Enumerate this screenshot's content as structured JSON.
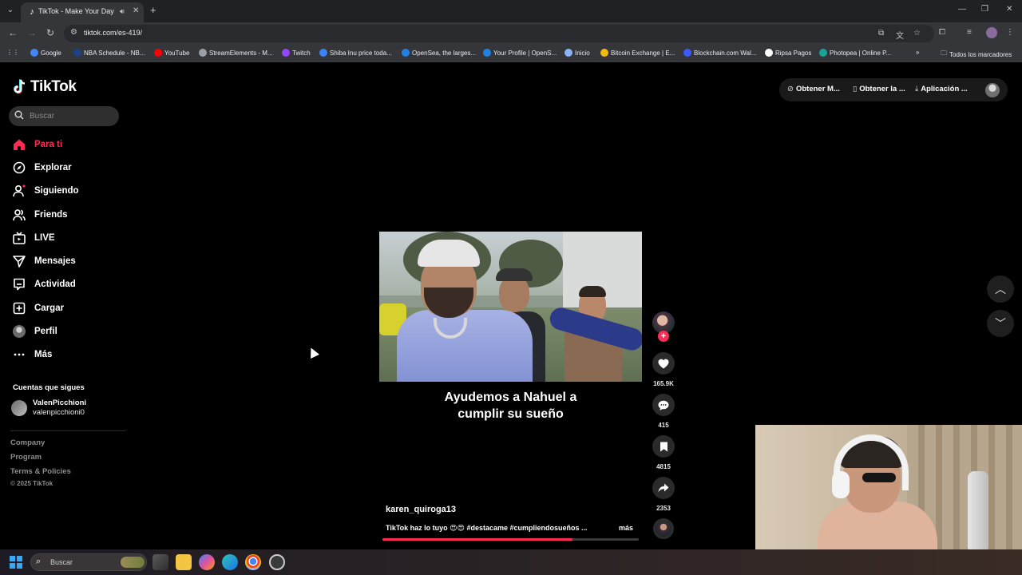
{
  "browser": {
    "tab_title": "TikTok - Make Your Day",
    "url": "tiktok.com/es-419/",
    "bookmarks": [
      {
        "label": "Google",
        "icon": "google-icon",
        "color": "#4285f4"
      },
      {
        "label": "NBA Schedule - NB...",
        "icon": "nba-icon",
        "color": "#1d428a"
      },
      {
        "label": "YouTube",
        "icon": "youtube-icon",
        "color": "#ff0000"
      },
      {
        "label": "StreamElements - M...",
        "icon": "streamelements-icon",
        "color": "#9aa0a6"
      },
      {
        "label": "Twitch",
        "icon": "twitch-icon",
        "color": "#9146ff"
      },
      {
        "label": "Shiba Inu price toda...",
        "icon": "coin-icon",
        "color": "#3b82f6"
      },
      {
        "label": "OpenSea, the larges...",
        "icon": "opensea-icon",
        "color": "#2081e2"
      },
      {
        "label": "Your Profile | OpenS...",
        "icon": "opensea-icon",
        "color": "#2081e2"
      },
      {
        "label": "Inicio",
        "icon": "cloud-icon",
        "color": "#8ab4f8"
      },
      {
        "label": "Bitcoin Exchange | E...",
        "icon": "binance-icon",
        "color": "#f0b90b"
      },
      {
        "label": "Blockchain.com Wal...",
        "icon": "blockchain-icon",
        "color": "#3d5afe"
      },
      {
        "label": "Ripsa Pagos",
        "icon": "ripsa-icon",
        "color": "#ffffff"
      },
      {
        "label": "Photopea | Online P...",
        "icon": "photopea-icon",
        "color": "#18a497"
      }
    ],
    "all_bookmarks": "Todos los marcadores"
  },
  "tiktok": {
    "logo": "TikTok",
    "search_placeholder": "Buscar",
    "nav": [
      {
        "label": "Para ti",
        "icon": "home-icon"
      },
      {
        "label": "Explorar",
        "icon": "compass-icon"
      },
      {
        "label": "Siguiendo",
        "icon": "following-icon"
      },
      {
        "label": "Friends",
        "icon": "friends-icon"
      },
      {
        "label": "LIVE",
        "icon": "live-icon"
      },
      {
        "label": "Mensajes",
        "icon": "messages-icon"
      },
      {
        "label": "Actividad",
        "icon": "activity-icon"
      },
      {
        "label": "Cargar",
        "icon": "upload-icon"
      },
      {
        "label": "Perfil",
        "icon": "profile-avatar"
      },
      {
        "label": "Más",
        "icon": "more-icon"
      }
    ],
    "following_header": "Cuentas que sigues",
    "following_account": {
      "name": "ValenPicchioni",
      "handle": "valenpicchioni0"
    },
    "footer": [
      "Company",
      "Program",
      "Terms & Policies"
    ],
    "copyright": "© 2025 TikTok",
    "top_actions": [
      "Obtener M...",
      "Obtener la ...",
      "Aplicación ..."
    ],
    "video": {
      "caption_line1": "Ayudemos a Nahuel a",
      "caption_line2": "cumplir su sueño",
      "author": "karen_quiroga13",
      "description": "TikTok haz lo tuyo 😍😍 #destacame #cumpliendosueños ...",
      "more": "más",
      "likes": "165.9K",
      "comments": "415",
      "saves": "4815",
      "shares": "2353",
      "progress": 0.74
    },
    "accent_color": "#fe2c55"
  },
  "taskbar": {
    "search_placeholder": "Buscar"
  }
}
